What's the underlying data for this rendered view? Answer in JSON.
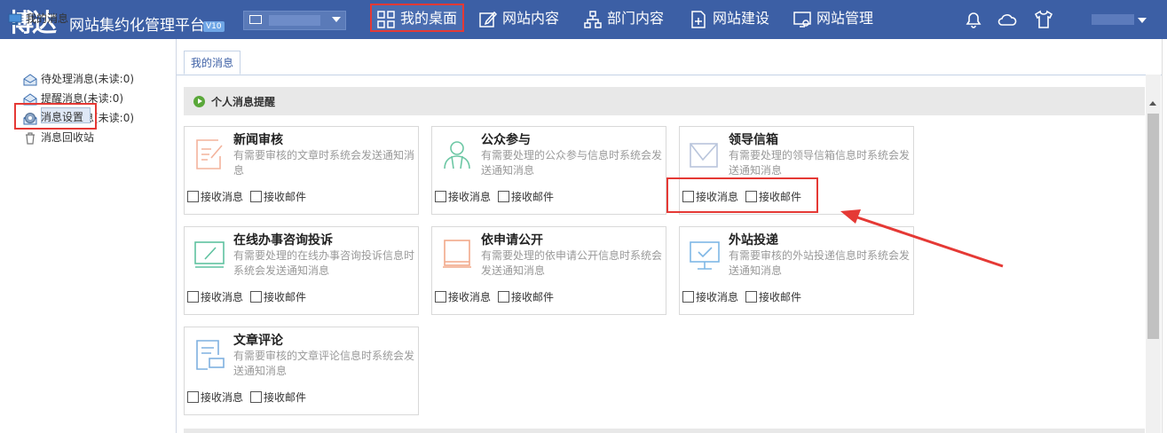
{
  "header": {
    "logo": "博达",
    "app_title": "网站集约化管理平台",
    "version_badge": "V10",
    "nav": [
      {
        "label": "我的桌面",
        "icon": "grid-icon",
        "active": true
      },
      {
        "label": "网站内容",
        "icon": "edit-icon"
      },
      {
        "label": "部门内容",
        "icon": "org-chart-icon"
      },
      {
        "label": "网站建设",
        "icon": "add-page-icon"
      },
      {
        "label": "网站管理",
        "icon": "monitor-settings-icon"
      }
    ],
    "icons": [
      "bell-icon",
      "cloud-icon",
      "shirt-icon"
    ]
  },
  "sidebar": {
    "root_label": "我的消息",
    "items": [
      {
        "label": "待处理消息(未读:0)",
        "icon": "envelope-icon"
      },
      {
        "label": "提醒消息(未读:0)",
        "icon": "envelope-icon"
      },
      {
        "label": "已处理消息(未读:0)",
        "icon": "envelope-icon"
      },
      {
        "label": "消息回收站",
        "icon": "trash-icon"
      },
      {
        "label": "消息设置",
        "icon": "gear-icon",
        "selected": true
      }
    ]
  },
  "main": {
    "tab": "我的消息",
    "section_title": "个人消息提醒",
    "option_message": "接收消息",
    "option_email": "接收邮件",
    "cards": [
      {
        "title": "新闻审核",
        "desc": "有需要审核的文章时系统会发送通知消息",
        "icon": "news-edit-icon"
      },
      {
        "title": "公众参与",
        "desc": "有需要处理的公众参与信息时系统会发送通知消息",
        "icon": "users-icon"
      },
      {
        "title": "领导信箱",
        "desc": "有需要处理的领导信箱信息时系统会发送通知消息",
        "icon": "mailbox-icon"
      },
      {
        "title": "在线办事咨询投诉",
        "desc": "有需要处理的在线办事咨询投诉信息时系统会发送通知消息",
        "icon": "edit-board-icon"
      },
      {
        "title": "依申请公开",
        "desc": "有需要处理的依申请公开信息时系统会发送通知消息",
        "icon": "book-icon"
      },
      {
        "title": "外站投递",
        "desc": "有需要审核的外站投递信息时系统会发送通知消息",
        "icon": "screen-check-icon"
      },
      {
        "title": "文章评论",
        "desc": "有需要审核的文章评论信息时系统会发送通知消息",
        "icon": "comment-doc-icon"
      }
    ]
  },
  "colors": {
    "header_bg": "#3c5fa5",
    "highlight": "#e53935",
    "section_bg": "#e8e8e8"
  }
}
